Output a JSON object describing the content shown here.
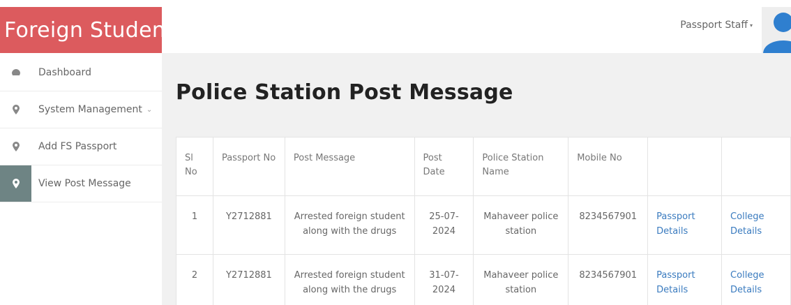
{
  "app": {
    "brand": "Foreign Student"
  },
  "header": {
    "user_label": "Passport Staff",
    "caret": "▾"
  },
  "sidebar": {
    "items": [
      {
        "label": "Dashboard",
        "icon": "dashboard-icon"
      },
      {
        "label": "System Management",
        "icon": "map-pin-icon",
        "chevron": "⌄"
      },
      {
        "label": "Add FS Passport",
        "icon": "map-pin-icon"
      },
      {
        "label": "View Post Message",
        "icon": "map-pin-icon",
        "active": true
      }
    ]
  },
  "page": {
    "title": "Police Station Post Message"
  },
  "table": {
    "headers": {
      "sl_no": "Sl No",
      "passport_no": "Passport No",
      "post_message": "Post Message",
      "post_date": "Post Date",
      "police_station": "Police Station Name",
      "mobile_no": "Mobile No"
    },
    "rows": [
      {
        "sl_no": "1",
        "passport_no": "Y2712881",
        "post_message": "Arrested foreign student along with the drugs",
        "post_date": "25-07-2024",
        "police_station": "Mahaveer police station",
        "mobile_no": "8234567901",
        "passport_link": "Passport Details",
        "college_link": "College Details"
      },
      {
        "sl_no": "2",
        "passport_no": "Y2712881",
        "post_message": "Arrested foreign student along with the drugs",
        "post_date": "31-07-2024",
        "police_station": "Mahaveer police station",
        "mobile_no": "8234567901",
        "passport_link": "Passport Details",
        "college_link": "College Details"
      }
    ]
  },
  "colors": {
    "brand_bg": "#dc5b5e",
    "active_icon_bg": "#6e8484",
    "link": "#3a7bbf",
    "avatar": "#2f7fcf"
  }
}
